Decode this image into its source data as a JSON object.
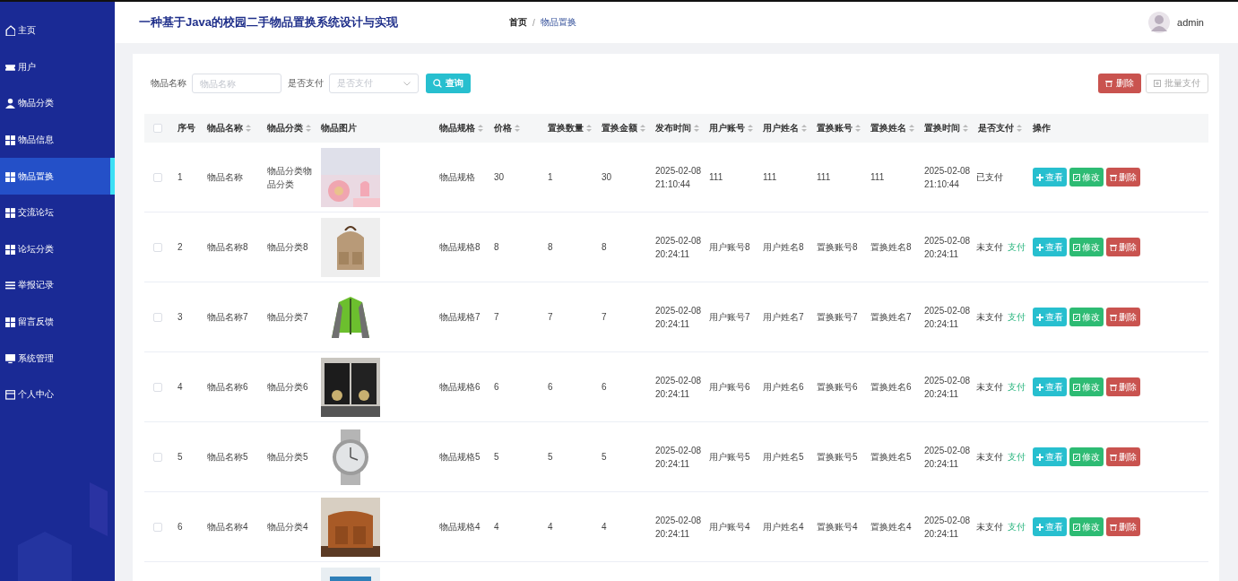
{
  "sidebar": {
    "items": [
      {
        "label": "主页",
        "selected": false
      },
      {
        "label": "用户",
        "selected": false
      },
      {
        "label": "物品分类",
        "selected": false
      },
      {
        "label": "物品信息",
        "selected": false
      },
      {
        "label": "物品置换",
        "selected": true
      },
      {
        "label": "交流论坛",
        "selected": false
      },
      {
        "label": "论坛分类",
        "selected": false
      },
      {
        "label": "举报记录",
        "selected": false
      },
      {
        "label": "留言反馈",
        "selected": false
      },
      {
        "label": "系统管理",
        "selected": false
      },
      {
        "label": "个人中心",
        "selected": false
      }
    ]
  },
  "header": {
    "title": "一种基于Java的校园二手物品置换系统设计与实现",
    "breadcrumb": [
      "首页",
      "物品置换"
    ],
    "breadcrumb_separator": "/",
    "user": "admin"
  },
  "search": {
    "fields": [
      {
        "kind": "input",
        "label": "物品名称",
        "placeholder": "物品名称"
      },
      {
        "kind": "select",
        "label": "是否支付",
        "placeholder": "是否支付"
      }
    ],
    "button": "查询"
  },
  "toolbar": [
    {
      "kind": "delete",
      "label": "删除",
      "disabled": false
    },
    {
      "kind": "pay",
      "label": "批量支付",
      "disabled": true
    }
  ],
  "table": {
    "select_all": {
      "checked": false
    },
    "columns": [
      {
        "label": "序号",
        "sortable": false
      },
      {
        "label": "物品名称",
        "sortable": true
      },
      {
        "label": "物品分类",
        "sortable": true
      },
      {
        "label": "物品图片",
        "sortable": false
      },
      {
        "label": "物品规格",
        "sortable": true
      },
      {
        "label": "价格",
        "sortable": true
      },
      {
        "label": "置换数量",
        "sortable": true
      },
      {
        "label": "置换金额",
        "sortable": true
      },
      {
        "label": "发布时间",
        "sortable": true
      },
      {
        "label": "用户账号",
        "sortable": true
      },
      {
        "label": "用户姓名",
        "sortable": true
      },
      {
        "label": "置换账号",
        "sortable": true
      },
      {
        "label": "置换姓名",
        "sortable": true
      },
      {
        "label": "置换时间",
        "sortable": true
      },
      {
        "label": "是否支付",
        "sortable": true
      },
      {
        "label": "操作",
        "sortable": false
      }
    ],
    "rows": [
      {
        "checked": false,
        "cells": [
          "1",
          "物品名称",
          "物品分类物品分类",
          "",
          "物品规格",
          "30",
          "1",
          "30",
          "2025-02-08 21:10:44",
          "111",
          "111",
          "111",
          "111",
          "2025-02-08 21:10:44"
        ],
        "status": "已支付",
        "actions": [
          {
            "kind": "view",
            "label": "查看"
          },
          {
            "kind": "edit",
            "label": "修改"
          },
          {
            "kind": "delete",
            "label": "删除"
          }
        ]
      },
      {
        "checked": false,
        "cells": [
          "2",
          "物品名称8",
          "物品分类8",
          "",
          "物品规格8",
          "8",
          "8",
          "8",
          "2025-02-08 20:24:11",
          "用户账号8",
          "用户姓名8",
          "置换账号8",
          "置换姓名8",
          "2025-02-08 20:24:11"
        ],
        "status": "未支付",
        "pay_link": "支付",
        "actions": [
          {
            "kind": "view",
            "label": "查看"
          },
          {
            "kind": "edit",
            "label": "修改"
          },
          {
            "kind": "delete",
            "label": "删除"
          }
        ]
      },
      {
        "checked": false,
        "cells": [
          "3",
          "物品名称7",
          "物品分类7",
          "",
          "物品规格7",
          "7",
          "7",
          "7",
          "2025-02-08 20:24:11",
          "用户账号7",
          "用户姓名7",
          "置换账号7",
          "置换姓名7",
          "2025-02-08 20:24:11"
        ],
        "status": "未支付",
        "pay_link": "支付",
        "actions": [
          {
            "kind": "view",
            "label": "查看"
          },
          {
            "kind": "edit",
            "label": "修改"
          },
          {
            "kind": "delete",
            "label": "删除"
          }
        ]
      },
      {
        "checked": false,
        "cells": [
          "4",
          "物品名称6",
          "物品分类6",
          "",
          "物品规格6",
          "6",
          "6",
          "6",
          "2025-02-08 20:24:11",
          "用户账号6",
          "用户姓名6",
          "置换账号6",
          "置换姓名6",
          "2025-02-08 20:24:11"
        ],
        "status": "未支付",
        "pay_link": "支付",
        "actions": [
          {
            "kind": "view",
            "label": "查看"
          },
          {
            "kind": "edit",
            "label": "修改"
          },
          {
            "kind": "delete",
            "label": "删除"
          }
        ]
      },
      {
        "checked": false,
        "cells": [
          "5",
          "物品名称5",
          "物品分类5",
          "",
          "物品规格5",
          "5",
          "5",
          "5",
          "2025-02-08 20:24:11",
          "用户账号5",
          "用户姓名5",
          "置换账号5",
          "置换姓名5",
          "2025-02-08 20:24:11"
        ],
        "status": "未支付",
        "pay_link": "支付",
        "actions": [
          {
            "kind": "view",
            "label": "查看"
          },
          {
            "kind": "edit",
            "label": "修改"
          },
          {
            "kind": "delete",
            "label": "删除"
          }
        ]
      },
      {
        "checked": false,
        "cells": [
          "6",
          "物品名称4",
          "物品分类4",
          "",
          "物品规格4",
          "4",
          "4",
          "4",
          "2025-02-08 20:24:11",
          "用户账号4",
          "用户姓名4",
          "置换账号4",
          "置换姓名4",
          "2025-02-08 20:24:11"
        ],
        "status": "未支付",
        "pay_link": "支付",
        "actions": [
          {
            "kind": "view",
            "label": "查看"
          },
          {
            "kind": "edit",
            "label": "修改"
          },
          {
            "kind": "delete",
            "label": "删除"
          }
        ]
      },
      {
        "kind": "cut"
      }
    ]
  }
}
